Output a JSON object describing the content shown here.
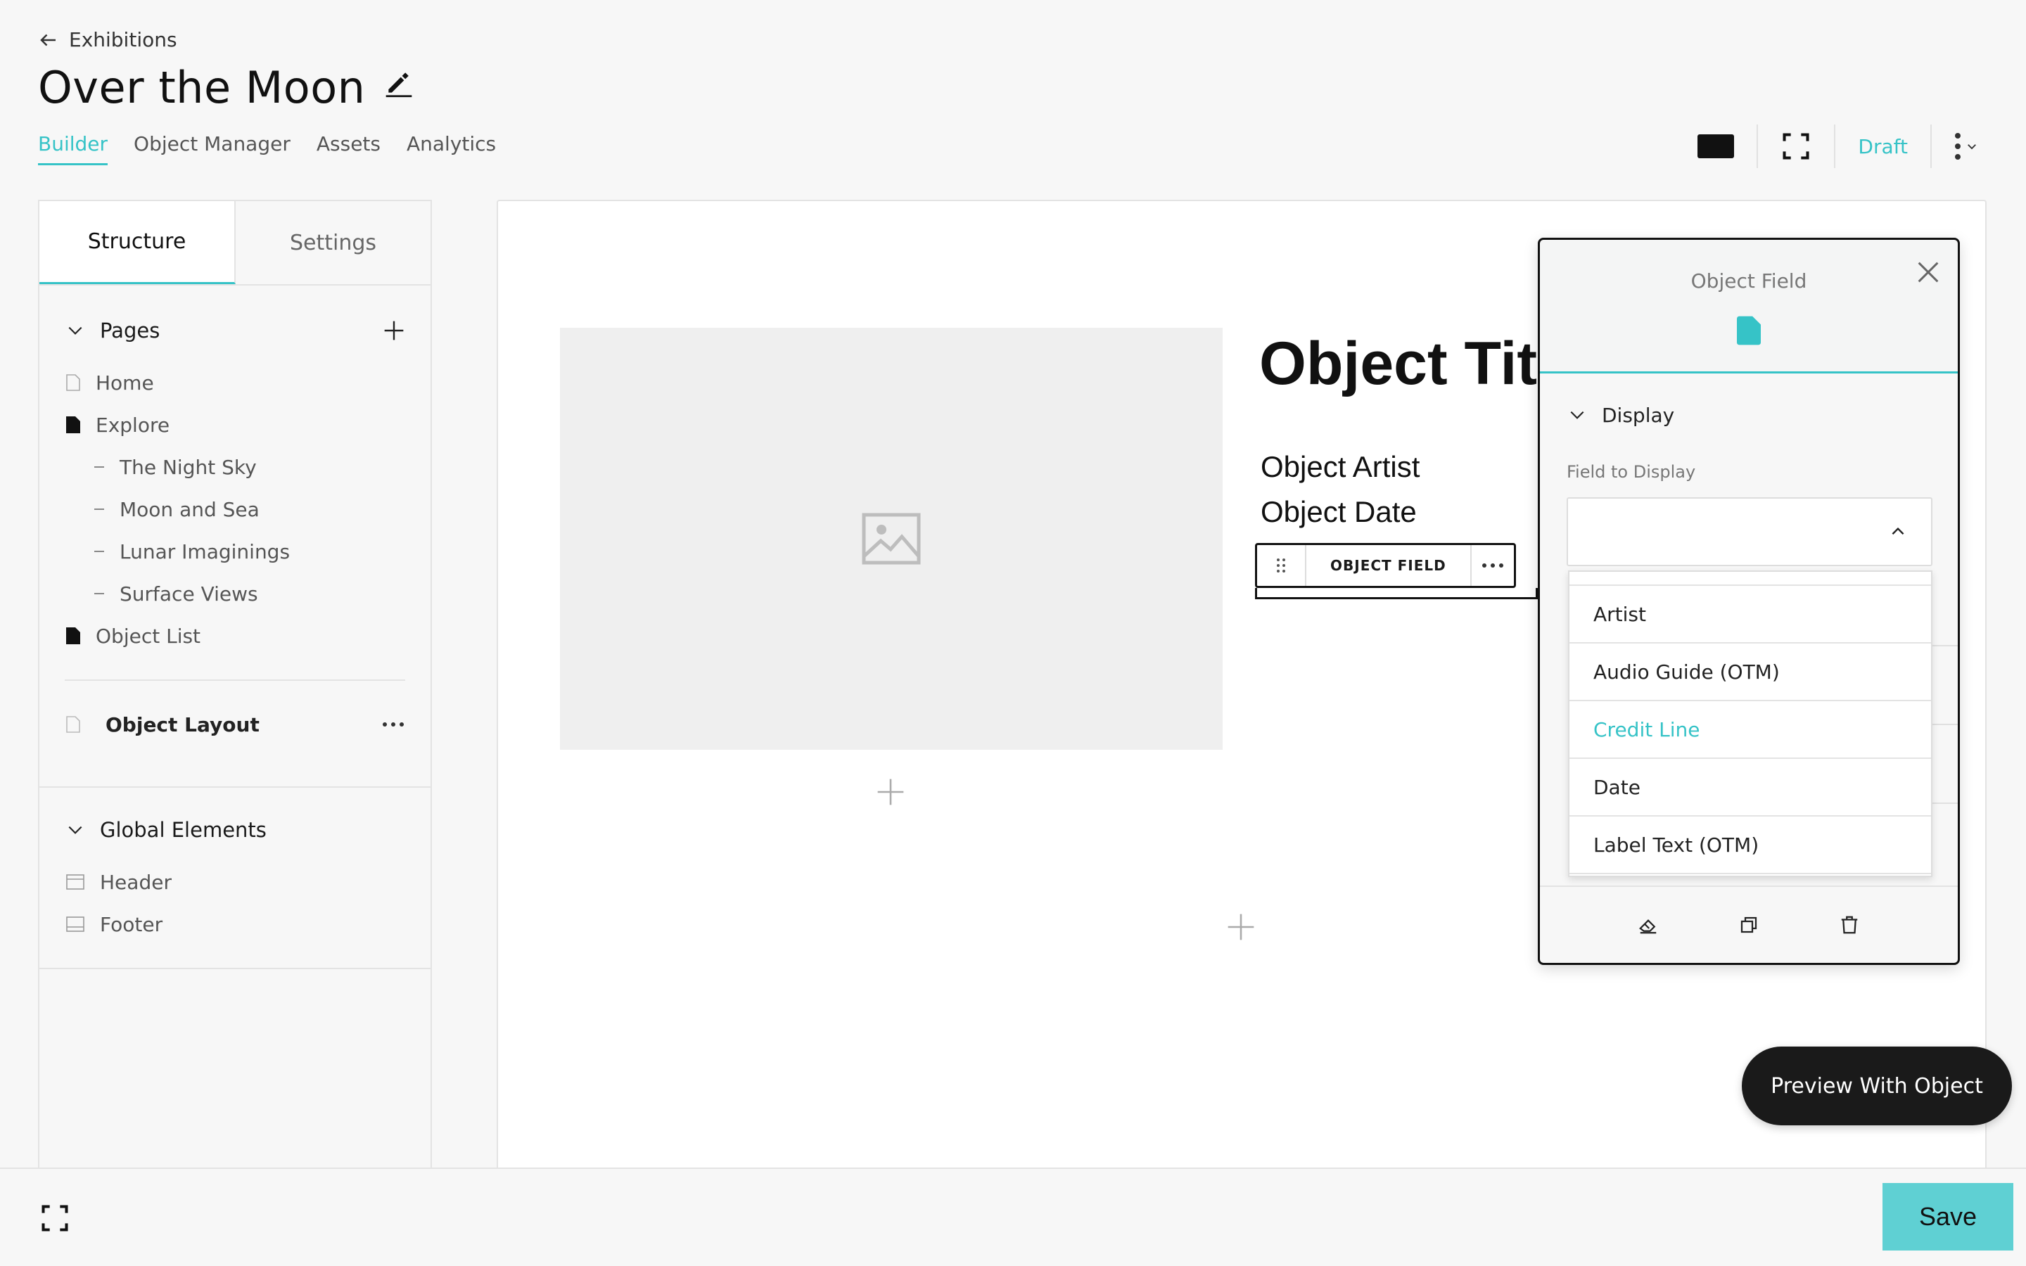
{
  "header": {
    "back_label": "Exhibitions",
    "title": "Over the Moon",
    "tabs": [
      {
        "label": "Builder"
      },
      {
        "label": "Object Manager"
      },
      {
        "label": "Assets"
      },
      {
        "label": "Analytics"
      }
    ],
    "status": "Draft"
  },
  "left_panel": {
    "tabs": [
      {
        "label": "Structure"
      },
      {
        "label": "Settings"
      }
    ],
    "pages_heading": "Pages",
    "pages": [
      {
        "label": "Home"
      },
      {
        "label": "Explore"
      },
      {
        "label": "The Night Sky"
      },
      {
        "label": "Moon and Sea"
      },
      {
        "label": "Lunar Imaginings"
      },
      {
        "label": "Surface Views"
      },
      {
        "label": "Object List"
      }
    ],
    "object_layout_label": "Object Layout",
    "global_heading": "Global Elements",
    "global_items": [
      {
        "label": "Header"
      },
      {
        "label": "Footer"
      }
    ]
  },
  "canvas": {
    "object_title": "Object Title",
    "object_artist": "Object Artist",
    "object_date": "Object Date",
    "field_toolbar_label": "OBJECT FIELD"
  },
  "object_field_panel": {
    "title": "Object Field",
    "section": "Display",
    "field_label": "Field to Display",
    "options": [
      {
        "label": "Artist"
      },
      {
        "label": "Audio Guide (OTM)"
      },
      {
        "label": "Credit Line"
      },
      {
        "label": "Date"
      },
      {
        "label": "Label Text (OTM)"
      }
    ],
    "accent_color": "#36c3c7"
  },
  "footer": {
    "preview_label": "Preview With Object",
    "save_label": "Save"
  }
}
